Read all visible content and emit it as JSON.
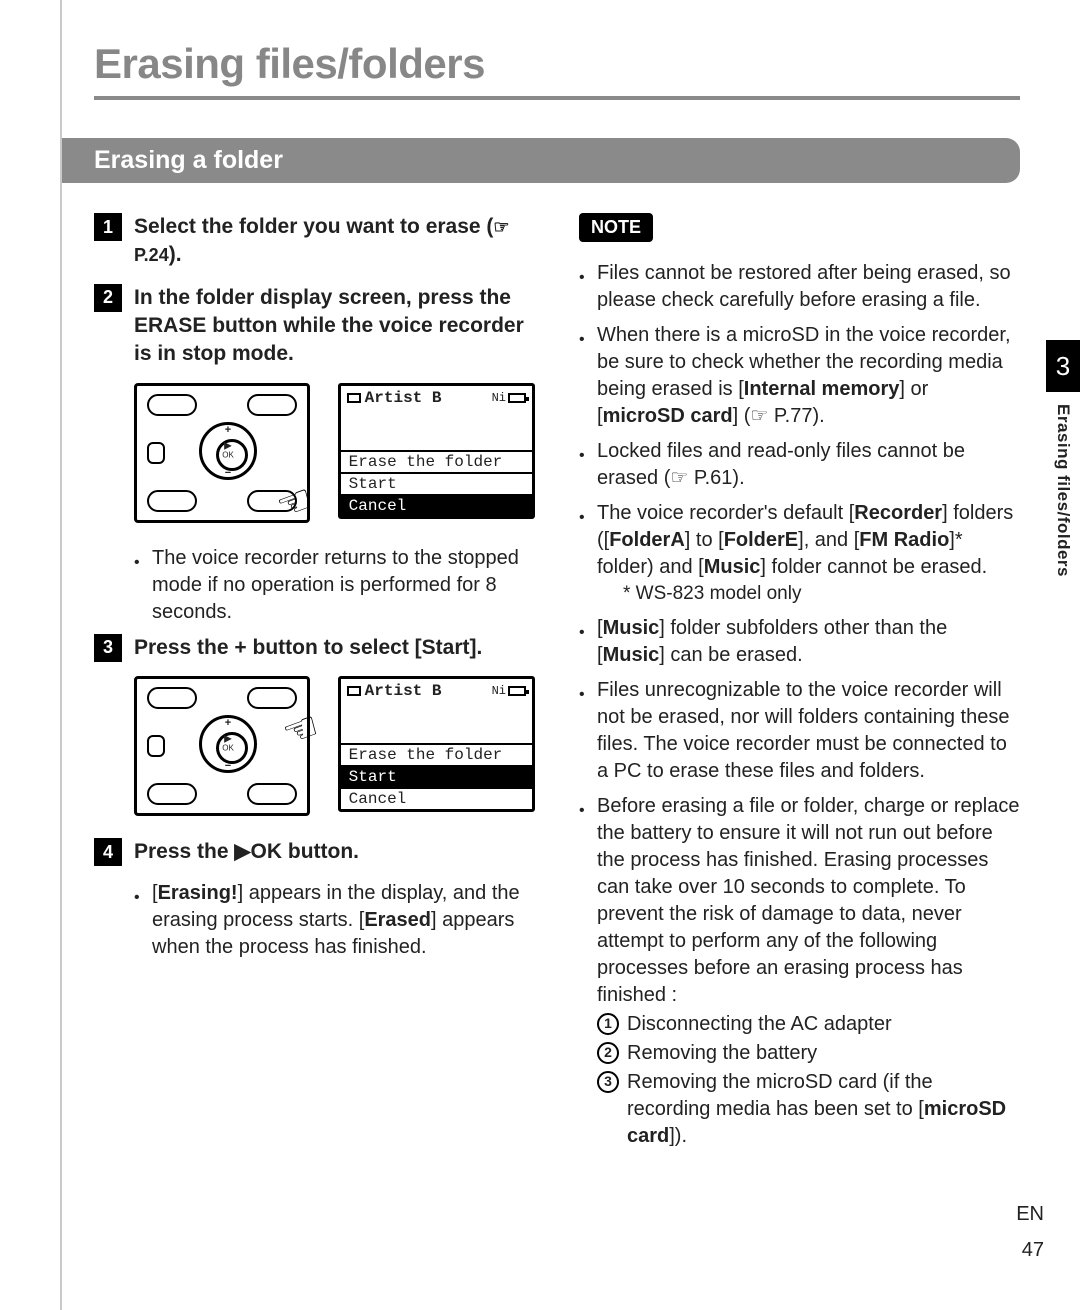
{
  "title": "Erasing files/folders",
  "subheader": "Erasing a folder",
  "side": {
    "chapter": "3",
    "label": "Erasing files/folders"
  },
  "footer": {
    "lang": "EN",
    "page": "47"
  },
  "steps": {
    "s1": {
      "num": "1",
      "text_a": "Select the folder you want to erase (",
      "ref": "☞ P.24",
      "text_b": ")."
    },
    "s2": {
      "num": "2",
      "text_a": "In the folder display screen, press the ",
      "bold": "ERASE",
      "text_b": " button while the voice recorder is in stop mode."
    },
    "s2_bullet": "The voice recorder returns to the stopped mode if no operation is performed for 8 seconds.",
    "s3": {
      "num": "3",
      "text_a": "Press the ",
      "bold": "+",
      "text_b": " button to select [",
      "bold2": "Start",
      "text_c": "]."
    },
    "s4": {
      "num": "4",
      "text_a": "Press the ",
      "ok": "▶OK",
      "text_b": " button."
    },
    "s4_bullet_a": "[",
    "s4_bullet_b": "Erasing!",
    "s4_bullet_c": "] appears in the display, and the erasing process starts. [",
    "s4_bullet_d": "Erased",
    "s4_bullet_e": "] appears when the process has finished."
  },
  "lcd": {
    "folder": "Artist B",
    "batt": "Ni",
    "line1": "Erase the folder",
    "opt_start": "Start",
    "opt_cancel": "Cancel"
  },
  "note": {
    "label": "NOTE",
    "n1": "Files cannot be restored after being erased, so please check carefully before erasing a file.",
    "n2_a": "When there is a microSD in the voice recorder, be sure to check whether the recording media being erased is [",
    "n2_b": "Internal memory",
    "n2_c": "] or [",
    "n2_d": "microSD card",
    "n2_e": "] (☞ P.77).",
    "n3": "Locked files and read-only files cannot be erased (☞ P.61).",
    "n4_a": "The voice recorder's default [",
    "n4_b": "Recorder",
    "n4_c": "] folders ([",
    "n4_d": "FolderA",
    "n4_e": "] to [",
    "n4_f": "FolderE",
    "n4_g": "], and [",
    "n4_h": "FM Radio",
    "n4_i": "]* folder) and [",
    "n4_j": "Music",
    "n4_k": "] folder cannot be erased.",
    "n4_sub": "* WS-823 model only",
    "n5_a": "[",
    "n5_b": "Music",
    "n5_c": "] folder subfolders other than the [",
    "n5_d": "Music",
    "n5_e": "] can be erased.",
    "n6": "Files unrecognizable to the voice recorder will not be erased, nor will folders containing these files. The voice recorder must be connected to a PC to erase these files and folders.",
    "n7": "Before erasing a file or folder, charge or replace the battery to ensure it will not run out before the process has finished. Erasing processes can take over 10 seconds to complete. To prevent the risk of damage to data, never attempt to perform any of the following processes before an erasing process has finished :",
    "e1": "Disconnecting the AC adapter",
    "e2": "Removing the battery",
    "e3_a": "Removing the microSD card (if the recording media has been set to [",
    "e3_b": "microSD card",
    "e3_c": "])."
  }
}
